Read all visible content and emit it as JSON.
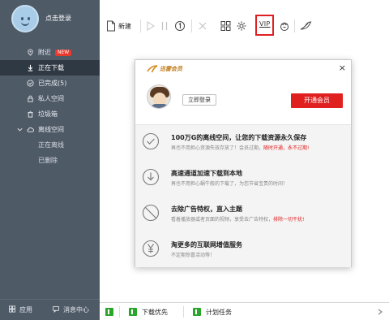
{
  "sidebar": {
    "login_text": "点击登录",
    "items": [
      {
        "label": "附近",
        "badge": "NEW",
        "icon": "location-pin-icon"
      },
      {
        "label": "正在下载",
        "icon": "download-arrow-icon"
      },
      {
        "label": "已完成(5)",
        "icon": "check-circle-icon"
      },
      {
        "label": "私人空间",
        "icon": "lock-icon"
      },
      {
        "label": "垃圾箱",
        "icon": "trash-icon"
      },
      {
        "label": "离线空间",
        "icon": "cloud-icon"
      },
      {
        "label": "正在离线"
      },
      {
        "label": "已删除"
      }
    ],
    "footer": {
      "apps": "应用",
      "messages": "消息中心"
    }
  },
  "toolbar": {
    "new_label": "新建",
    "vip_label": "VIP"
  },
  "popup": {
    "logo_text": "迅雷会员",
    "close": "×",
    "login_button": "立即登录",
    "vip_button": "开通会员",
    "features": [
      {
        "title": "100万G的离线空间，让您的下载资源永久保存",
        "desc_a": "再也不用担心资源失效存放了！会员过期，",
        "desc_b": "随时开通，永不过期!",
        "icon": "check-circle-icon"
      },
      {
        "title": "高速通道加速下载到本地",
        "desc_a": "再也不用担心蜗牛般的下载了，为您节省宝贵的时间！",
        "desc_b": "",
        "icon": "download-circle-icon"
      },
      {
        "title": "去除广告特权，直入主题",
        "desc_a": "看着播放器或者页面的视频，享受去广告特权，",
        "desc_b": "排除一切干扰!",
        "icon": "no-ads-icon"
      },
      {
        "title": "淘更多的互联网增值服务",
        "desc_a": "不定期惊喜活动等！",
        "desc_b": "",
        "icon": "yen-circle-icon"
      }
    ]
  },
  "bottombar": {
    "priority_label": "下载优先",
    "schedule_label": "计划任务"
  },
  "colors": {
    "sidebar": "#4f5a67",
    "sidebar_active": "#2f3944",
    "accent_red": "#e0201f",
    "chip_green": "#2aa52a"
  }
}
